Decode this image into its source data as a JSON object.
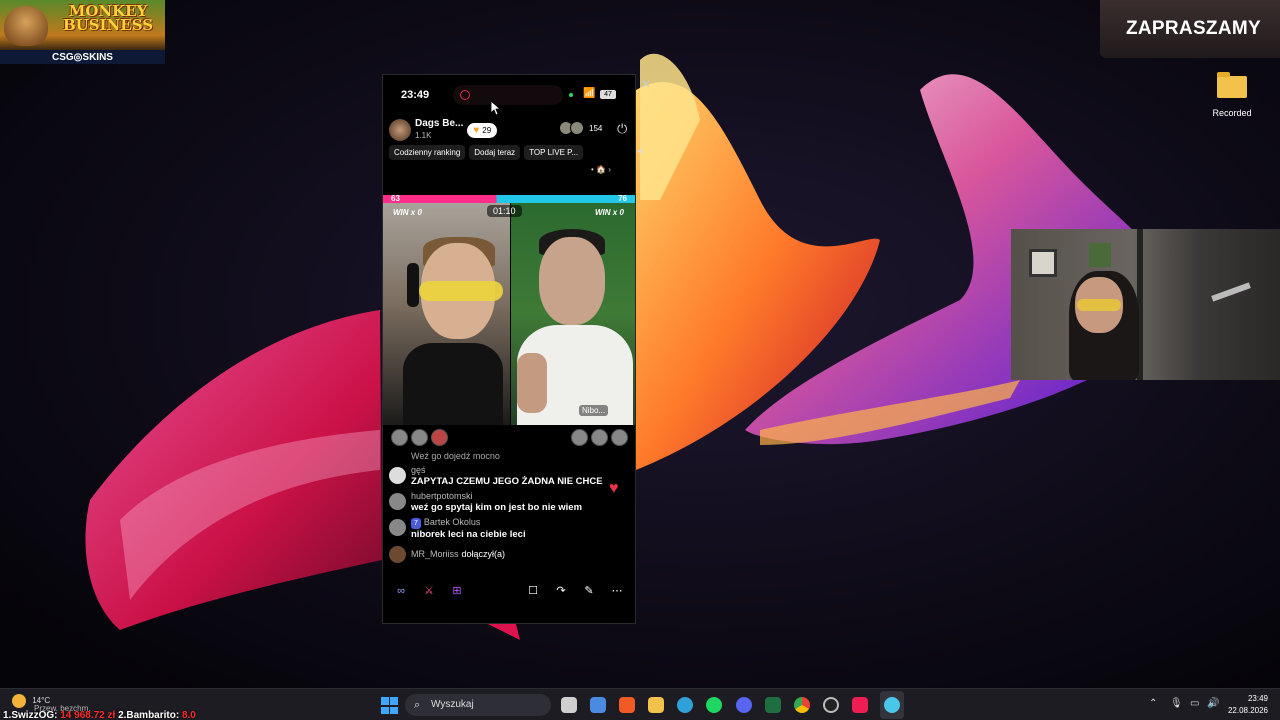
{
  "overlays": {
    "game_title": "MONKEY BUSINESS",
    "game_brand": "CSG◎SKINS",
    "banner": "ZAPRASZAMY"
  },
  "desktop": {
    "icons": [
      {
        "label": "Recorded",
        "icon": "folder-icon"
      }
    ]
  },
  "phone": {
    "status": {
      "time": "23:49",
      "battery": "47"
    },
    "host": {
      "name": "Dags Be...",
      "followers": "1.1K",
      "likes": "29"
    },
    "viewers": "154",
    "chips": [
      "Codzienny ranking",
      "Dodaj teraz",
      "TOP LIVE P..."
    ],
    "battle": {
      "score_left": "63",
      "score_right": "76",
      "timer": "01:10",
      "win_left": "WIN x 0",
      "win_right": "WIN x 0",
      "right_name": "Nibo..."
    },
    "chat": {
      "first_line": "Weź go dojedź mocno",
      "messages": [
        {
          "user": "gęś",
          "text": "ZAPYTAJ CZEMU JEGO ŻADNA NIE CHCE",
          "badge": ""
        },
        {
          "user": "hubertpotomski",
          "text": "weź go spytaj kim on jest bo nie wiem",
          "badge": ""
        },
        {
          "user": "Bartek Okolus",
          "text": "niborek leci na ciebie leci",
          "badge": "7"
        }
      ],
      "join": {
        "user": "MR_Moriiss",
        "text": "dołączył(a)"
      }
    }
  },
  "taskbar": {
    "weather": {
      "temp": "14°C",
      "desc": "Przew. bezchm."
    },
    "search_placeholder": "Wyszukaj",
    "clock": {
      "time": "23:49",
      "date": "22.08.2026"
    },
    "ranking": {
      "first": "1.SwizzOG:",
      "first_amount": "14 968.72 zł",
      "second": "2.Bambarito:",
      "second_amount": "8.0"
    }
  },
  "colors": {
    "pink": "#ff2d87",
    "cyan": "#22c7e8",
    "heart": "#e8334a",
    "accent_blue": "#3ea7ff"
  }
}
